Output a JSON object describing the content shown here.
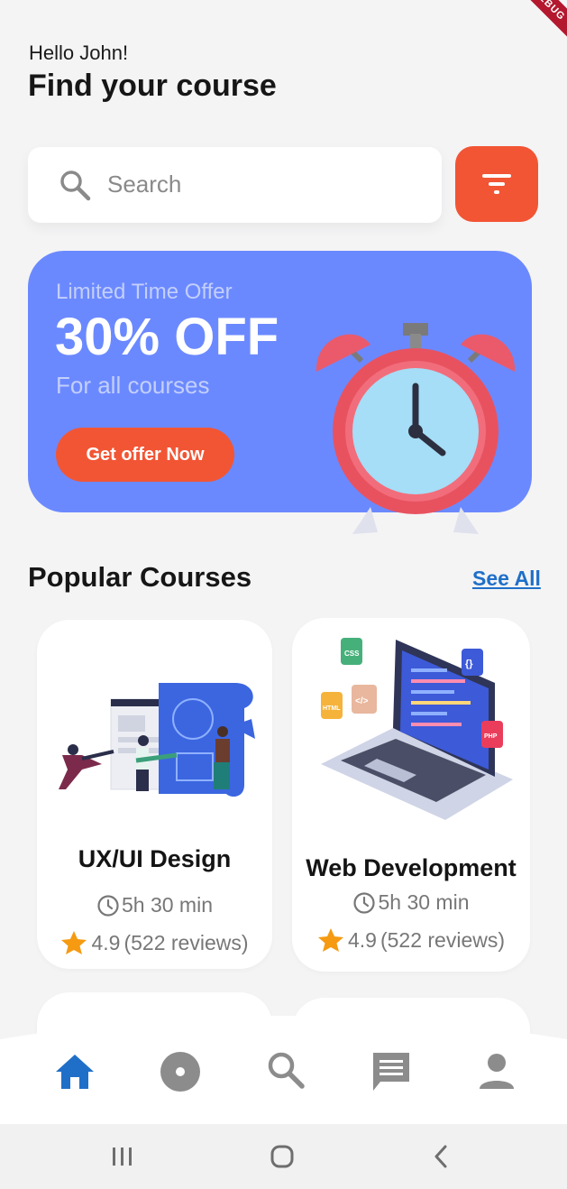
{
  "debug_banner": "DEBUG",
  "header": {
    "greeting": "Hello John!",
    "title": "Find your course"
  },
  "search": {
    "placeholder": "Search",
    "value": ""
  },
  "promo": {
    "eyebrow": "Limited Time Offer",
    "headline": "30% OFF",
    "subtitle": "For all courses",
    "cta_label": "Get offer Now"
  },
  "popular": {
    "title": "Popular Courses",
    "see_all": "See All",
    "courses": [
      {
        "title": "UX/UI Design",
        "duration": "5h 30 min",
        "rating": "4.9",
        "reviews": "(522 reviews)"
      },
      {
        "title": "Web Development",
        "duration": "5h 30 min",
        "rating": "4.9",
        "reviews": "(522 reviews)",
        "badges": [
          "CSS",
          "HTML",
          "PHP"
        ]
      }
    ]
  },
  "nav": {
    "items": [
      "home-icon",
      "disc-icon",
      "search-icon",
      "chat-icon",
      "profile-icon"
    ],
    "active": "home-icon"
  },
  "colors": {
    "accent": "#f25534",
    "promo_bg": "#6b89ff",
    "link": "#1f6fc8",
    "nav_active": "#1f6fc8",
    "nav_inactive": "#8c8c8c",
    "star": "#f59a11"
  }
}
